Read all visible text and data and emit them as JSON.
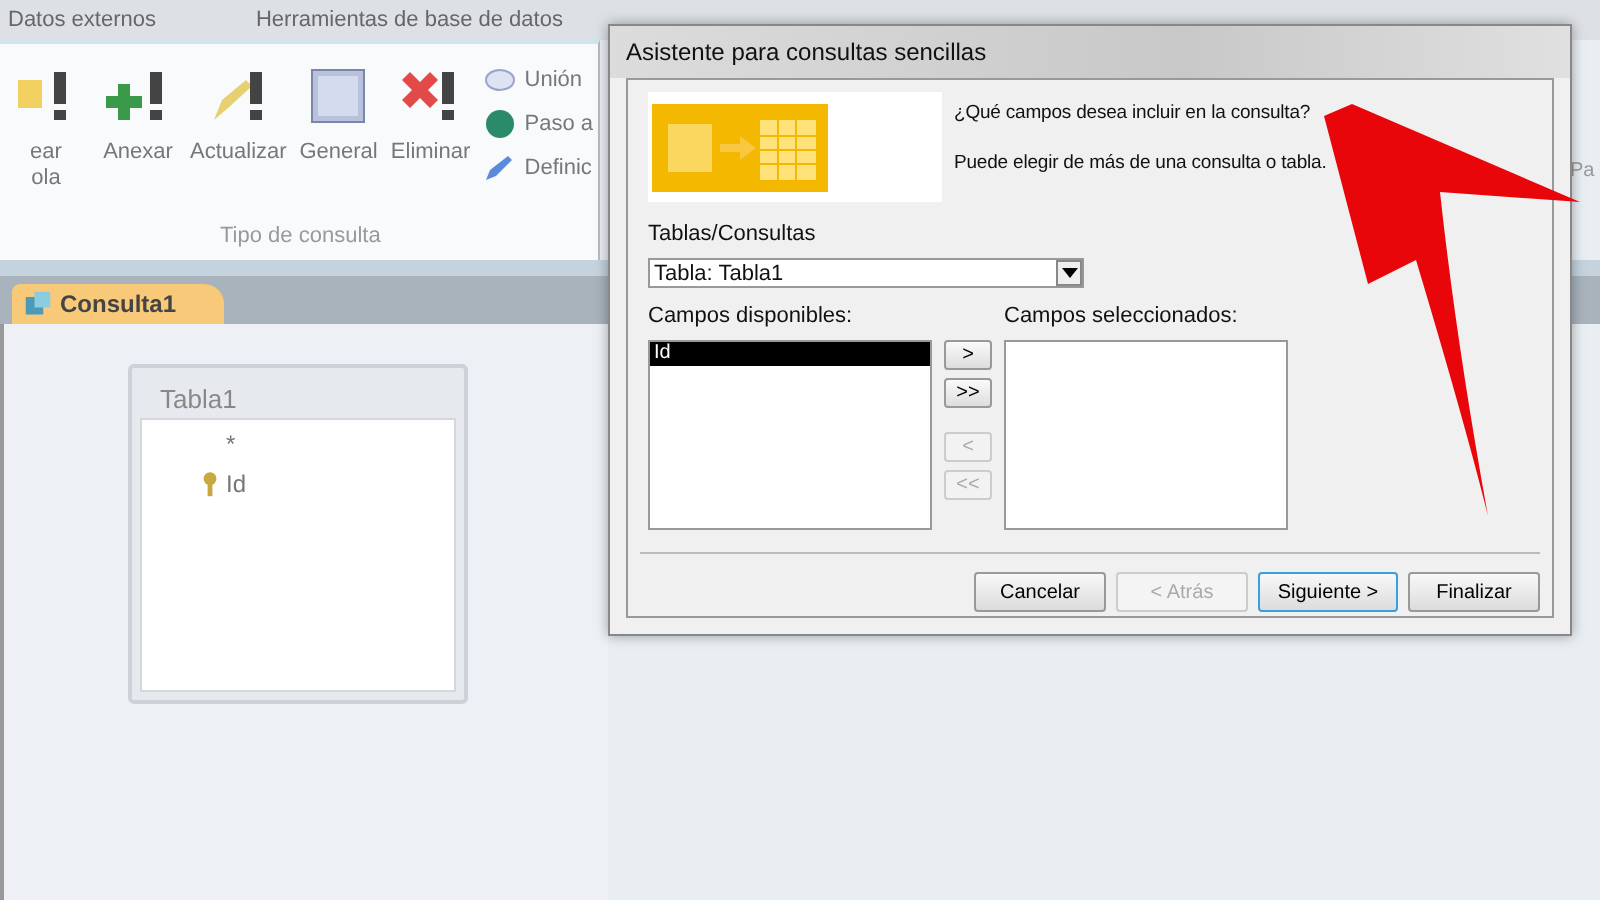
{
  "ribbon_tabs": [
    {
      "label": "Datos externos"
    },
    {
      "label": "Herramientas de base de datos"
    }
  ],
  "ribbon": {
    "large_buttons": [
      {
        "kind": "make-table",
        "lines": [
          "ear",
          "ola"
        ]
      },
      {
        "kind": "append",
        "lines": [
          "Anexar"
        ]
      },
      {
        "kind": "update",
        "lines": [
          "Actualizar"
        ]
      },
      {
        "kind": "general",
        "lines": [
          "General"
        ]
      },
      {
        "kind": "delete",
        "lines": [
          "Eliminar"
        ]
      }
    ],
    "small_buttons": [
      {
        "kind": "union",
        "label": "Unión"
      },
      {
        "kind": "passthrough",
        "label": "Paso a"
      },
      {
        "kind": "definition",
        "label": "Definic"
      }
    ],
    "group_label": "Tipo de consulta",
    "side_label": "Pa"
  },
  "document_tabs": [
    {
      "label": "Consulta1",
      "selected": true
    }
  ],
  "table_box": {
    "title": "Tabla1",
    "fields": [
      {
        "name": "*",
        "key": false
      },
      {
        "name": "Id",
        "key": true
      }
    ]
  },
  "dialog": {
    "title": "Asistente para consultas sencillas",
    "question": "¿Qué campos desea incluir en la consulta?",
    "hint": "Puede elegir de más de una consulta o tabla.",
    "source_label": "Tablas/Consultas",
    "source_value": "Tabla: Tabla1",
    "available_label": "Campos disponibles:",
    "selected_label": "Campos seleccionados:",
    "available_fields": [
      {
        "label": "Id",
        "selected": true
      }
    ],
    "move_buttons": [
      {
        "label": ">",
        "disabled": false
      },
      {
        "label": ">>",
        "disabled": false
      },
      {
        "label": "<",
        "disabled": true
      },
      {
        "label": "<<",
        "disabled": true
      }
    ],
    "footer_buttons": [
      {
        "label": "Cancelar",
        "disabled": false,
        "default": false
      },
      {
        "label": "< Atrás",
        "disabled": true,
        "default": false
      },
      {
        "label": "Siguiente >",
        "disabled": false,
        "default": true
      },
      {
        "label": "Finalizar",
        "disabled": false,
        "default": false
      }
    ]
  }
}
